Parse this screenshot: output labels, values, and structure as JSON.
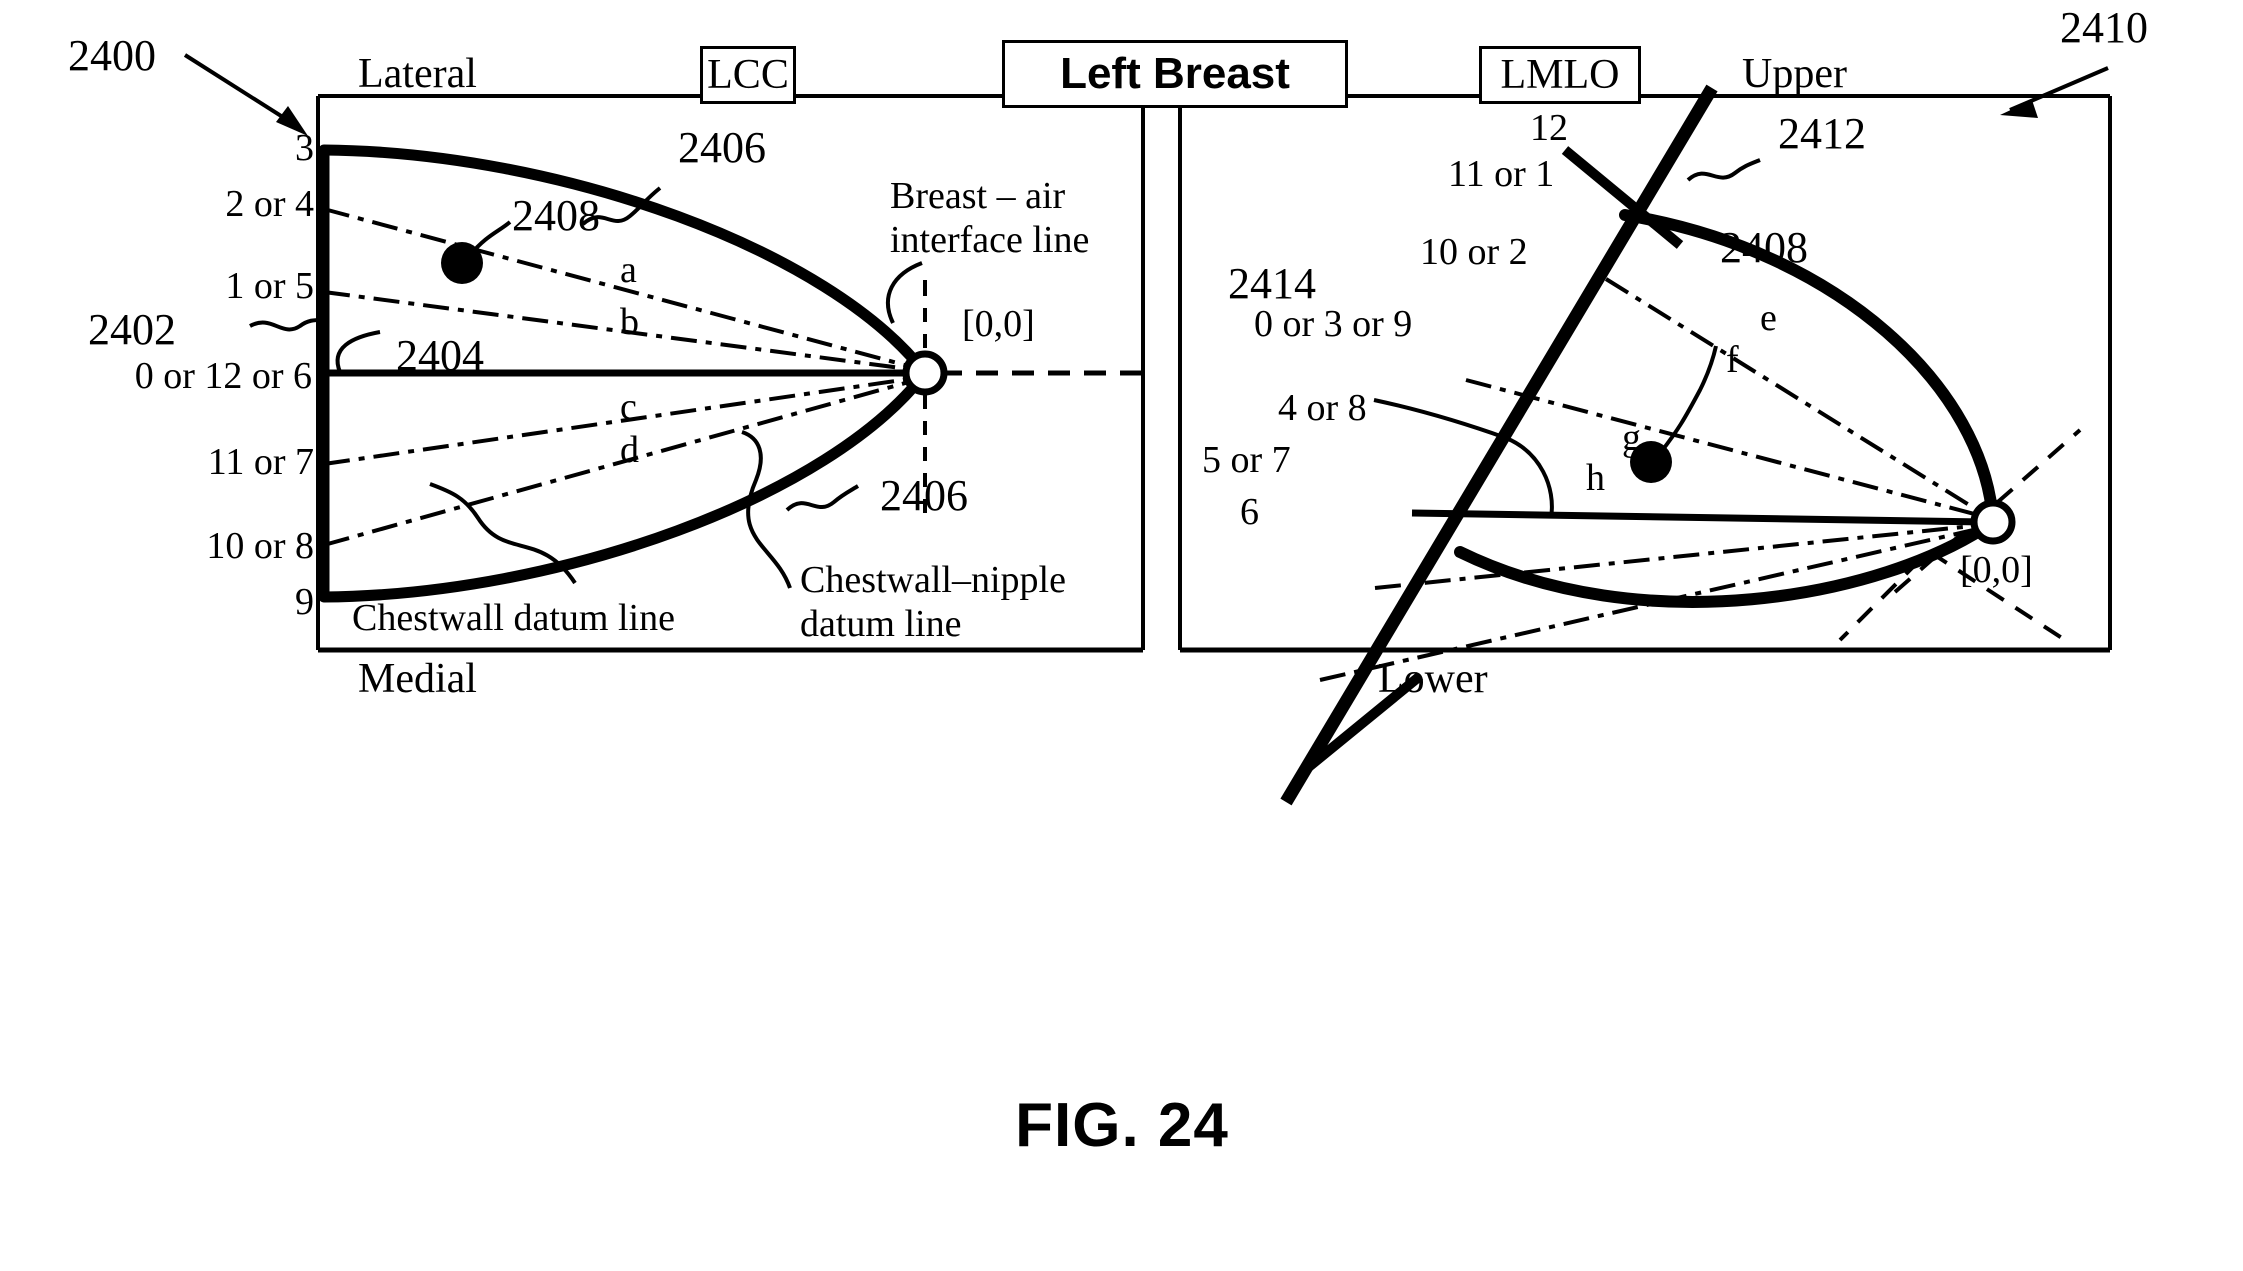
{
  "figure": {
    "caption": "FIG. 24",
    "ref_main": "2400",
    "ref_right": "2410"
  },
  "headers": {
    "lcc": "LCC",
    "left_breast": "Left Breast",
    "lmlo": "LMLO"
  },
  "left_panel": {
    "name": "LCC view",
    "orientation_top": "Lateral",
    "orientation_bottom": "Medial",
    "refs": {
      "chestwall_datum": "2402",
      "chestwall_nipple_datum": "2404",
      "breast_air_interface_top": "2406",
      "breast_air_interface_bottom": "2406",
      "lesion": "2408"
    },
    "clock_labels": [
      "3",
      "2 or 4",
      "1 or 5",
      "0 or 12 or 6",
      "11 or 7",
      "10 or 8",
      "9"
    ],
    "ray_labels": [
      "a",
      "b",
      "c",
      "d"
    ],
    "origin_label": "[0,0]",
    "callouts": {
      "breast_air_interface_line": "Breast – air\ninterface line",
      "breast_air_interface_line_1": "Breast –  air",
      "breast_air_interface_line_2": "interface line",
      "chestwall_datum_line": "Chestwall datum line",
      "chestwall_nipple_datum_line_1": "Chestwall–nipple",
      "chestwall_nipple_datum_line_2": "datum line"
    }
  },
  "right_panel": {
    "name": "LMLO view",
    "orientation_top": "Upper",
    "orientation_bottom": "Lower",
    "refs": {
      "breast_air_interface": "2412",
      "chestwall_datum": "2414",
      "lesion": "2408"
    },
    "clock_labels": [
      "12",
      "11 or 1",
      "10 or 2",
      "0 or 3 or 9",
      "4 or 8",
      "5 or 7",
      "6"
    ],
    "ray_labels": [
      "e",
      "f",
      "g",
      "h"
    ],
    "origin_label": "[0,0]"
  }
}
